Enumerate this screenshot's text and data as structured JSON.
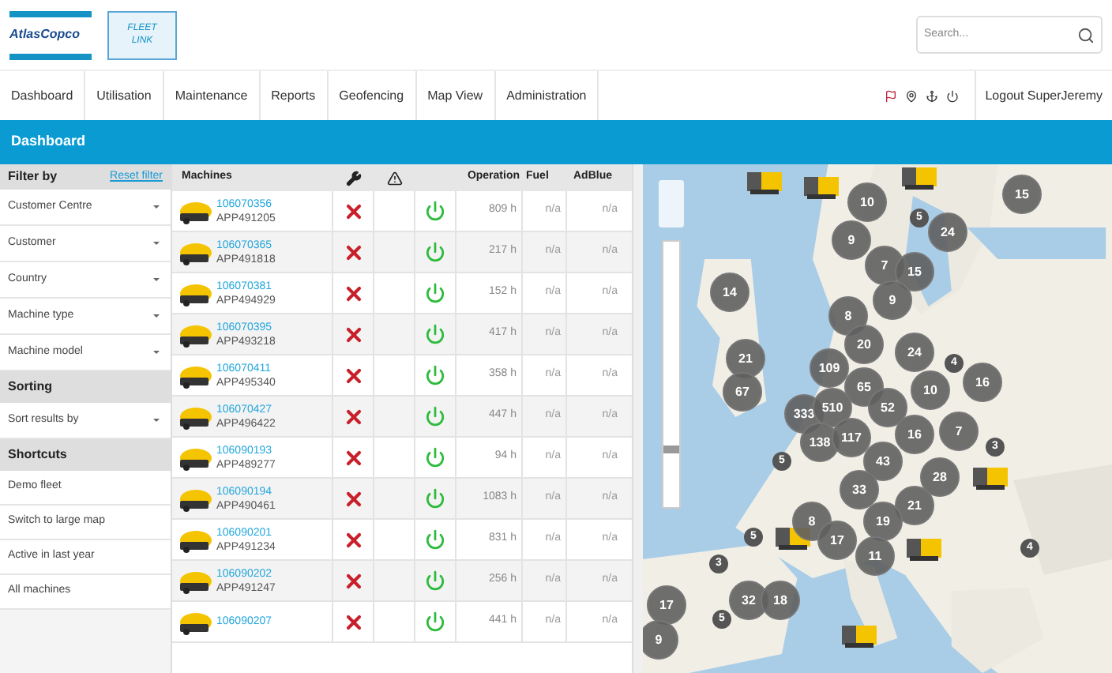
{
  "header": {
    "logo_text": "AtlasCopco",
    "app_logo": [
      "FLEET",
      "LINK"
    ],
    "search": {
      "placeholder": "Search..."
    }
  },
  "nav": {
    "items": [
      "Dashboard",
      "Utilisation",
      "Maintenance",
      "Reports",
      "Geofencing",
      "Map View",
      "Administration"
    ],
    "logout": "Logout SuperJeremy"
  },
  "title_bar": "Dashboard",
  "sidebar": {
    "filter_title": "Filter by",
    "reset": "Reset filter",
    "items": [
      {
        "kind": "dropdown",
        "label": "Customer Centre"
      },
      {
        "kind": "dropdown",
        "label": "Customer"
      },
      {
        "kind": "dropdown",
        "label": "Country"
      },
      {
        "kind": "dropdown",
        "label": "Machine type"
      },
      {
        "kind": "dropdown",
        "label": "Machine model"
      },
      {
        "kind": "section",
        "label": "Sorting"
      },
      {
        "kind": "dropdown",
        "label": "Sort results by"
      },
      {
        "kind": "section",
        "label": "Shortcuts"
      },
      {
        "kind": "link",
        "label": "Demo fleet"
      },
      {
        "kind": "link",
        "label": "Switch to large map"
      },
      {
        "kind": "link",
        "label": "Active in last year"
      },
      {
        "kind": "link",
        "label": "All machines"
      }
    ]
  },
  "table": {
    "columns": [
      "Machines",
      "Operation",
      "Fuel",
      "AdBlue"
    ],
    "rows": [
      {
        "id": "106070356",
        "app": "APP491205",
        "on": true,
        "operation": "809 h",
        "fuel": "n/a",
        "adblue": "n/a"
      },
      {
        "id": "106070365",
        "app": "APP491818",
        "on": true,
        "operation": "217 h",
        "fuel": "n/a",
        "adblue": "n/a"
      },
      {
        "id": "106070381",
        "app": "APP494929",
        "on": true,
        "operation": "152 h",
        "fuel": "n/a",
        "adblue": "n/a"
      },
      {
        "id": "106070395",
        "app": "APP493218",
        "on": true,
        "operation": "417 h",
        "fuel": "n/a",
        "adblue": "n/a"
      },
      {
        "id": "106070411",
        "app": "APP495340",
        "on": true,
        "operation": "358 h",
        "fuel": "n/a",
        "adblue": "n/a"
      },
      {
        "id": "106070427",
        "app": "APP496422",
        "on": true,
        "operation": "447 h",
        "fuel": "n/a",
        "adblue": "n/a"
      },
      {
        "id": "106090193",
        "app": "APP489277",
        "on": true,
        "operation": "94 h",
        "fuel": "n/a",
        "adblue": "n/a"
      },
      {
        "id": "106090194",
        "app": "APP490461",
        "on": true,
        "operation": "1083 h",
        "fuel": "n/a",
        "adblue": "n/a"
      },
      {
        "id": "106090201",
        "app": "APP491234",
        "on": true,
        "operation": "831 h",
        "fuel": "n/a",
        "adblue": "n/a"
      },
      {
        "id": "106090202",
        "app": "APP491247",
        "on": true,
        "operation": "256 h",
        "fuel": "n/a",
        "adblue": "n/a"
      },
      {
        "id": "106090207",
        "on": true,
        "operation": "441 h",
        "fuel": "n/a",
        "adblue": "n/a"
      }
    ]
  },
  "map": {
    "zoom": {
      "level": 0.2
    },
    "markers": [
      {
        "kind": "cluster",
        "count": "10"
      },
      {
        "kind": "cluster",
        "count": "9"
      },
      {
        "kind": "small",
        "count": "5"
      },
      {
        "kind": "cluster",
        "count": "24"
      },
      {
        "kind": "cluster",
        "count": "15"
      },
      {
        "kind": "cluster",
        "count": "7"
      },
      {
        "kind": "cluster",
        "count": "15"
      },
      {
        "kind": "cluster",
        "count": "9"
      },
      {
        "kind": "cluster",
        "count": "14"
      },
      {
        "kind": "cluster",
        "count": "8"
      },
      {
        "kind": "cluster",
        "count": "20"
      },
      {
        "kind": "cluster",
        "count": "24"
      },
      {
        "kind": "small",
        "count": "4"
      },
      {
        "kind": "cluster",
        "count": "21"
      },
      {
        "kind": "cluster",
        "count": "109"
      },
      {
        "kind": "cluster",
        "count": "65"
      },
      {
        "kind": "cluster",
        "count": "10"
      },
      {
        "kind": "cluster",
        "count": "16"
      },
      {
        "kind": "cluster",
        "count": "67"
      },
      {
        "kind": "cluster",
        "count": "333"
      },
      {
        "kind": "cluster",
        "count": "510"
      },
      {
        "kind": "cluster",
        "count": "52"
      },
      {
        "kind": "cluster",
        "count": "138"
      },
      {
        "kind": "cluster",
        "count": "117"
      },
      {
        "kind": "cluster",
        "count": "16"
      },
      {
        "kind": "cluster",
        "count": "7"
      },
      {
        "kind": "small",
        "count": "5"
      },
      {
        "kind": "small",
        "count": "3"
      },
      {
        "kind": "cluster",
        "count": "43"
      },
      {
        "kind": "cluster",
        "count": "28"
      },
      {
        "kind": "cluster",
        "count": "33"
      },
      {
        "kind": "cluster",
        "count": "21"
      },
      {
        "kind": "cluster",
        "count": "8"
      },
      {
        "kind": "cluster",
        "count": "19"
      },
      {
        "kind": "cluster",
        "count": "17"
      },
      {
        "kind": "small",
        "count": "5"
      },
      {
        "kind": "cluster",
        "count": "11"
      },
      {
        "kind": "small",
        "count": "3"
      },
      {
        "kind": "small",
        "count": "4"
      },
      {
        "kind": "cluster",
        "count": "17"
      },
      {
        "kind": "cluster",
        "count": "32"
      },
      {
        "kind": "cluster",
        "count": "18"
      },
      {
        "kind": "small",
        "count": "5"
      },
      {
        "kind": "cluster",
        "count": "9"
      },
      {
        "kind": "machine"
      },
      {
        "kind": "machine"
      },
      {
        "kind": "machine"
      },
      {
        "kind": "machine"
      },
      {
        "kind": "machine"
      },
      {
        "kind": "machine"
      },
      {
        "kind": "machine"
      }
    ]
  }
}
